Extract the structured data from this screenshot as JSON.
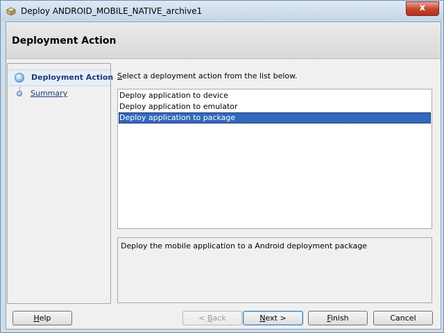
{
  "window": {
    "title": "Deploy ANDROID_MOBILE_NATIVE_archive1",
    "close_glyph": "x"
  },
  "header": {
    "title": "Deployment Action"
  },
  "nav": {
    "items": [
      {
        "label": "Deployment Action",
        "state": "active"
      },
      {
        "label": "Summary",
        "state": "link"
      }
    ]
  },
  "main": {
    "instruction_first": "S",
    "instruction_rest": "elect a deployment action from the list below.",
    "actions": [
      {
        "label": "Deploy application to device",
        "selected": false
      },
      {
        "label": "Deploy application to emulator",
        "selected": false
      },
      {
        "label": "Deploy application to package",
        "selected": true
      }
    ],
    "description": "Deploy the mobile application to a Android deployment package"
  },
  "buttons": {
    "help": {
      "mnemonic": "H",
      "rest": "elp"
    },
    "back": {
      "prefix": "< ",
      "mnemonic": "B",
      "rest": "ack",
      "enabled": false
    },
    "next": {
      "mnemonic": "N",
      "rest": "ext >",
      "default": true
    },
    "finish": {
      "mnemonic": "F",
      "rest": "inish"
    },
    "cancel": {
      "label": "Cancel"
    }
  },
  "colors": {
    "selection": "#3268bd",
    "nav_text": "#1f3a78",
    "title_gradient_top": "#dfe9f4",
    "close_button": "#c7432a"
  },
  "icons": {
    "app": "deploy-package-icon",
    "close": "close-icon",
    "nav_active": "current-step-icon",
    "nav_pending": "pending-step-icon"
  }
}
